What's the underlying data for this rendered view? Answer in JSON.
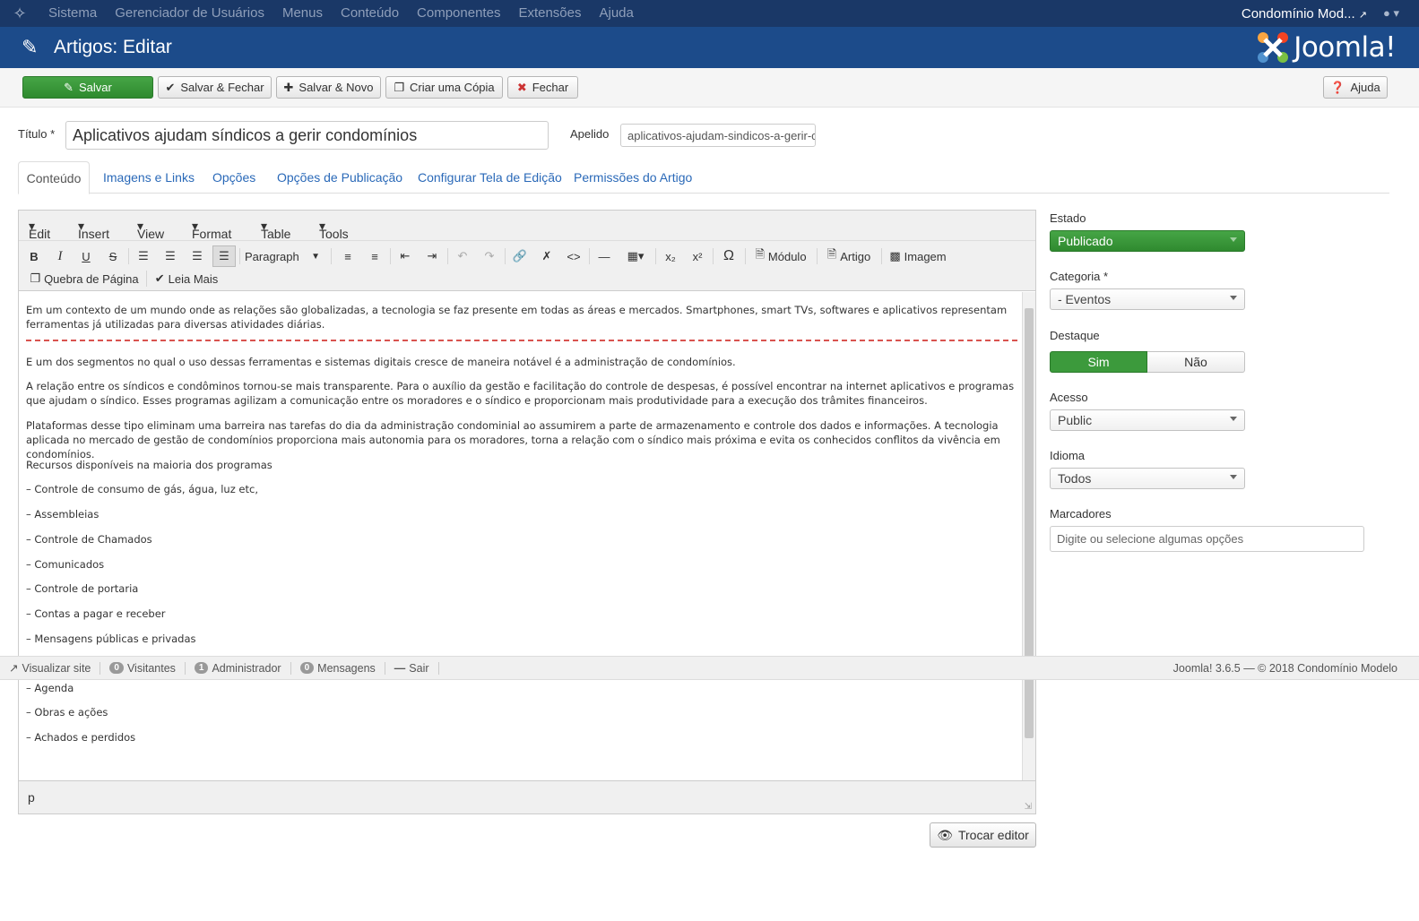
{
  "topnav": {
    "menu": [
      "Sistema",
      "Gerenciador de Usuários",
      "Menus",
      "Conteúdo",
      "Componentes",
      "Extensões",
      "Ajuda"
    ],
    "site_name": "Condomínio Mod..."
  },
  "header": {
    "title": "Artigos: Editar",
    "logo_text": "Joomla!"
  },
  "toolbar": {
    "save": "Salvar",
    "save_close": "Salvar & Fechar",
    "save_new": "Salvar & Novo",
    "save_copy": "Criar uma Cópia",
    "close": "Fechar",
    "help": "Ajuda"
  },
  "form": {
    "title_label": "Título *",
    "title_value": "Aplicativos ajudam síndicos a gerir condomínios",
    "alias_label": "Apelido",
    "alias_value": "aplicativos-ajudam-sindicos-a-gerir-c"
  },
  "tabs": [
    "Conteúdo",
    "Imagens e Links",
    "Opções",
    "Opções de Publicação",
    "Configurar Tela de Edição",
    "Permissões do Artigo"
  ],
  "editor": {
    "menus": [
      "Edit",
      "Insert",
      "View",
      "Format",
      "Table",
      "Tools"
    ],
    "format_select": "Paragraph",
    "buttons": {
      "module": "Módulo",
      "article": "Artigo",
      "image": "Imagem",
      "pagebreak": "Quebra de Página",
      "readmore": "Leia Mais"
    },
    "paragraphs": [
      "Em um contexto de um mundo onde as relações são globalizadas, a tecnologia se faz presente em todas as áreas e mercados. Smartphones, smart TVs, softwares e aplicativos representam ferramentas já utilizadas para diversas atividades diárias.",
      "E um dos segmentos no qual o uso dessas ferramentas e sistemas digitais cresce de maneira notável é a administração de condomínios.",
      "A relação entre os síndicos e condôminos tornou-se mais transparente. Para o auxílio da gestão e facilitação do controle de despesas, é possível encontrar na internet aplicativos e programas que ajudam o síndico. Esses programas agilizam a comunicação entre os moradores e o síndico e proporcionam mais produtividade para a execução dos trâmites financeiros.",
      "Plataformas desse tipo eliminam uma barreira nas tarefas do dia da administração condominial ao assumirem a parte de armazenamento e controle dos dados e informações. A tecnologia aplicada no mercado de gestão de condomínios proporciona mais autonomia para os moradores, torna a relação com o síndico mais próxima e evita os conhecidos conflitos da vivência em condomínios.",
      "Recursos disponíveis na maioria dos programas",
      "– Controle de consumo de gás, água, luz etc,",
      "– Assembleias",
      "– Controle de Chamados",
      "– Comunicados",
      "– Controle de portaria",
      "– Contas a pagar e receber",
      "– Mensagens públicas e privadas",
      "– Agenda",
      "– Obras e ações",
      "– Achados e perdidos"
    ],
    "status_path": "p"
  },
  "switch_editor": "Trocar editor",
  "sidebar": {
    "estado_label": "Estado",
    "estado_value": "Publicado",
    "categoria_label": "Categoria *",
    "categoria_value": "- Eventos",
    "destaque_label": "Destaque",
    "destaque_yes": "Sim",
    "destaque_no": "Não",
    "acesso_label": "Acesso",
    "acesso_value": "Public",
    "idioma_label": "Idioma",
    "idioma_value": "Todos",
    "marcadores_label": "Marcadores",
    "marcadores_placeholder": "Digite ou selecione algumas opções"
  },
  "footer": {
    "view_site": "Visualizar site",
    "visitors_count": "0",
    "visitors": "Visitantes",
    "admin_count": "1",
    "admin": "Administrador",
    "messages_count": "0",
    "messages": "Mensagens",
    "logout": "Sair",
    "copyright": "Joomla! 3.6.5  —  © 2018 Condomínio Modelo"
  },
  "colors": {
    "topnav": "#1a3867",
    "header": "#1c4b8a",
    "success": "#3c9a3c",
    "link": "#2a69b8"
  }
}
